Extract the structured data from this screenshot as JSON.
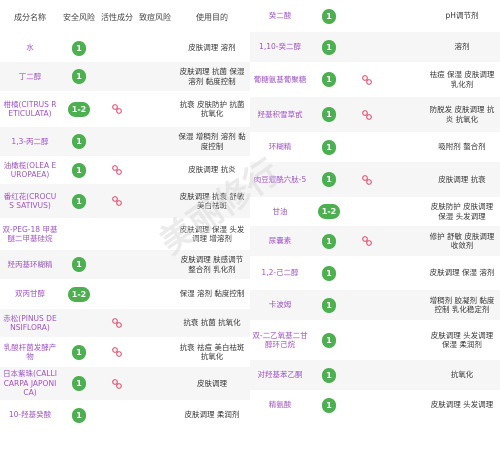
{
  "headers": {
    "name": "成分名称",
    "safety": "安全风险",
    "active": "活性成分",
    "acne": "致痘风险",
    "purpose": "使用目的"
  },
  "left_rows": [
    {
      "name": "水",
      "safety": "1",
      "purpose": "皮肤调理 溶剂",
      "active": false
    },
    {
      "name": "丁二醇",
      "safety": "1",
      "purpose": "皮肤调理 抗菌 保湿 溶剂 黏度控制",
      "active": false
    },
    {
      "name": "柑橘(CITRUS RETICULATA)",
      "safety": "1-2",
      "purpose": "抗衰 皮肤防护 抗菌 抗氧化",
      "active": true
    },
    {
      "name": "1,3-丙二醇",
      "safety": "1",
      "purpose": "保湿 增稠剂 溶剂 黏度控制",
      "active": false
    },
    {
      "name": "油橄榄(OLEA EUROPAEA)",
      "safety": "1",
      "purpose": "皮肤调理 抗炎",
      "active": true
    },
    {
      "name": "番红花(CROCUS SATIVUS)",
      "safety": "1",
      "purpose": "皮肤调理 抗衰 舒敏 美白祛斑",
      "active": true
    },
    {
      "name": "双-PEG-18 甲基醚二甲基硅烷",
      "safety": "",
      "purpose": "皮肤调理 保湿 头发调理 增溶剂",
      "active": false
    },
    {
      "name": "羟丙基环糊精",
      "safety": "1",
      "purpose": "皮肤调理 肤感调节 整合剂 乳化剂",
      "active": false
    },
    {
      "name": "双丙甘醇",
      "safety": "1-2",
      "purpose": "保湿 溶剂 黏度控制",
      "active": false
    },
    {
      "name": "赤松(PINUS DENSIFLORA)",
      "safety": "",
      "purpose": "抗衰 抗菌 抗氧化",
      "active": true
    },
    {
      "name": "乳酸杆菌发酵产物",
      "safety": "1",
      "purpose": "抗衰 祛痘 美白祛斑 抗氧化",
      "active": true
    },
    {
      "name": "日本紫珠(CALLICARPA JAPONICA)",
      "safety": "1",
      "purpose": "皮肤调理",
      "active": true
    },
    {
      "name": "10-羟基癸酸",
      "safety": "1",
      "purpose": "皮肤调理 柔润剂",
      "active": false
    }
  ],
  "right_rows": [
    {
      "name": "癸二酸",
      "safety": "1",
      "purpose": "pH调节剂",
      "active": false
    },
    {
      "name": "1,10-癸二醇",
      "safety": "1",
      "purpose": "溶剂",
      "active": false
    },
    {
      "name": "葡糖氨基葡聚糖",
      "safety": "1",
      "purpose": "祛痘 保湿 皮肤调理 乳化剂",
      "active": true
    },
    {
      "name": "羟基积雪草甙",
      "safety": "1",
      "purpose": "防脱发 皮肤调理 抗炎 抗氧化",
      "active": true
    },
    {
      "name": "环糊精",
      "safety": "1",
      "purpose": "吸附剂 螯合剂",
      "active": false
    },
    {
      "name": "肉豆蔻酰六肽-5",
      "safety": "1",
      "purpose": "皮肤调理 抗衰",
      "active": true
    },
    {
      "name": "甘油",
      "safety": "1-2",
      "purpose": "皮肤防护 皮肤调理 保湿 头发调理",
      "active": false
    },
    {
      "name": "尿囊素",
      "safety": "1",
      "purpose": "修护 舒敏 皮肤调理 收敛剂",
      "active": true
    },
    {
      "name": "1,2-己二醇",
      "safety": "1",
      "purpose": "皮肤调理 保湿 溶剂",
      "active": false
    },
    {
      "name": "卡波姆",
      "safety": "1",
      "purpose": "增稠剂 胶凝剂 黏度控制 乳化稳定剂",
      "active": false
    },
    {
      "name": "双-二乙氧基二甘醇环己烷",
      "safety": "1",
      "purpose": "皮肤调理 头发调理 保湿 柔润剂",
      "active": false
    },
    {
      "name": "对羟基苯乙酮",
      "safety": "1",
      "purpose": "抗氧化",
      "active": false
    },
    {
      "name": "精氨酸",
      "safety": "1",
      "purpose": "皮肤调理 头发调理",
      "active": false
    }
  ],
  "watermark": "美丽修行",
  "colors": {
    "badge": "#4caf50",
    "name": "#a052c6",
    "active_icon": "#e05a7a"
  }
}
